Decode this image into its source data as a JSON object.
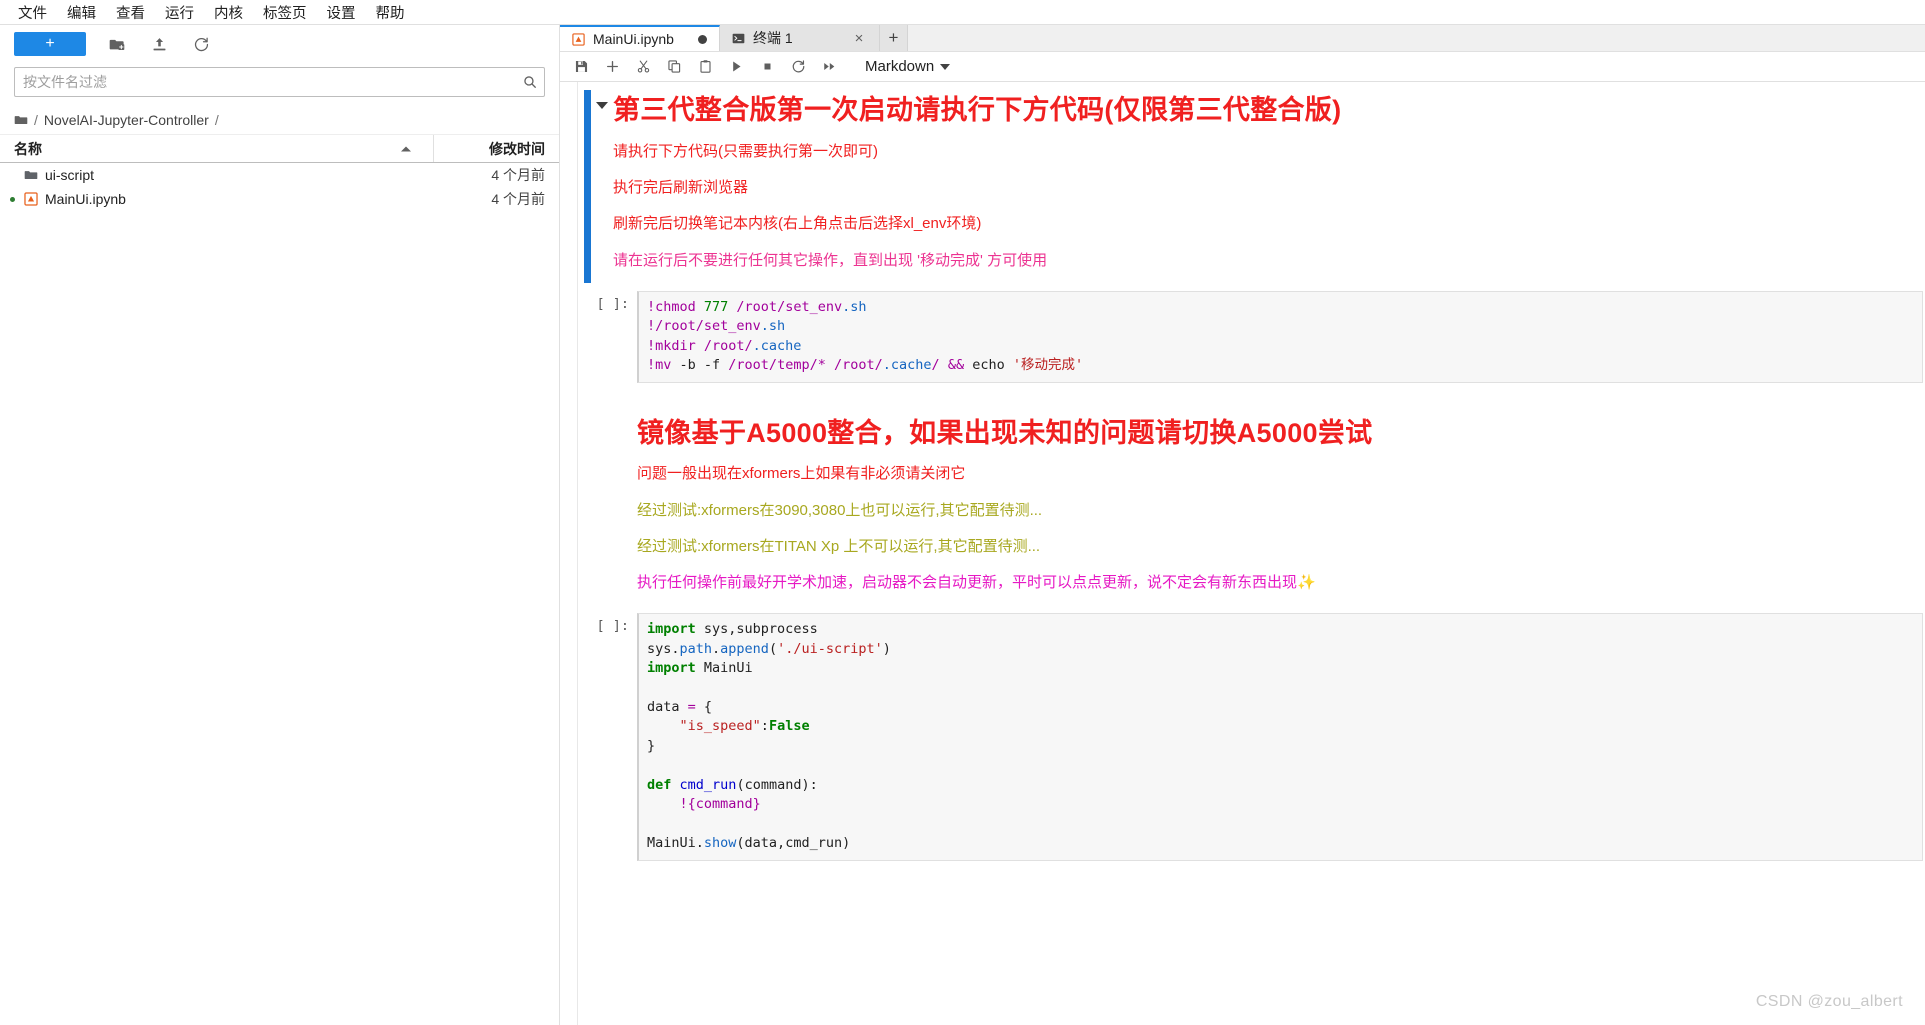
{
  "menubar": {
    "items": [
      {
        "label": "文件",
        "name": "menu-file"
      },
      {
        "label": "编辑",
        "name": "menu-edit"
      },
      {
        "label": "查看",
        "name": "menu-view"
      },
      {
        "label": "运行",
        "name": "menu-run"
      },
      {
        "label": "内核",
        "name": "menu-kernel"
      },
      {
        "label": "标签页",
        "name": "menu-tabs"
      },
      {
        "label": "设置",
        "name": "menu-settings"
      },
      {
        "label": "帮助",
        "name": "menu-help"
      }
    ]
  },
  "sidebar": {
    "toolbar": {
      "new_label": "+",
      "new_color": "#1e88e5",
      "icons": [
        {
          "name": "new-folder-icon",
          "title": "新建文件夹"
        },
        {
          "name": "upload-icon",
          "title": "上传"
        },
        {
          "name": "refresh-icon",
          "title": "刷新"
        }
      ]
    },
    "filter": {
      "placeholder": "按文件名过滤",
      "value": "",
      "icon": "search-icon"
    },
    "breadcrumb": {
      "icon": "folder-icon",
      "lead_sep": "/",
      "path": "NovelAI-Jupyter-Controller",
      "trail_sep": "/"
    },
    "list_headers": {
      "name": "名称",
      "modified": "修改时间",
      "sort": "ascending"
    },
    "files": [
      {
        "name": "ui-script",
        "modified": "4 个月前",
        "type": "folder",
        "icon": "folder-icon",
        "running": false
      },
      {
        "name": "MainUi.ipynb",
        "modified": "4 个月前",
        "type": "notebook",
        "icon": "notebook-icon",
        "running": true
      }
    ]
  },
  "tabs": [
    {
      "label": "MainUi.ipynb",
      "icon": "notebook-icon",
      "active": true,
      "dirty": true,
      "closable": false
    },
    {
      "label": "终端 1",
      "icon": "terminal-icon",
      "active": false,
      "dirty": false,
      "closable": true,
      "close_label": "×"
    }
  ],
  "tab_add_label": "+",
  "notebook_toolbar": {
    "buttons": [
      {
        "name": "save-button",
        "icon": "save-icon",
        "title": "保存"
      },
      {
        "name": "insert-cell-button",
        "icon": "plus-icon",
        "title": "插入单元"
      },
      {
        "name": "cut-cell-button",
        "icon": "scissors-icon",
        "title": "剪切"
      },
      {
        "name": "copy-cell-button",
        "icon": "copy-icon",
        "title": "复制"
      },
      {
        "name": "paste-cell-button",
        "icon": "paste-icon",
        "title": "粘贴"
      },
      {
        "name": "run-cell-button",
        "icon": "play-icon",
        "title": "运行"
      },
      {
        "name": "stop-kernel-button",
        "icon": "stop-icon",
        "title": "中断"
      },
      {
        "name": "restart-kernel-button",
        "icon": "restart-icon",
        "title": "重启"
      },
      {
        "name": "restart-run-all-button",
        "icon": "fast-forward-icon",
        "title": "重启并运行全部"
      }
    ],
    "cell_type": "Markdown"
  },
  "notebook": {
    "cells": [
      {
        "id": "cell-md-1",
        "type": "markdown",
        "selected": true,
        "collapsible": true,
        "heading": "第三代整合版第一次启动请执行下方代码(仅限第三代整合版)",
        "heading_color": "#f02020",
        "paragraphs": [
          {
            "text": "请执行下方代码(只需要执行第一次即可)",
            "color": "#f02020"
          },
          {
            "text": "执行完后刷新浏览器",
            "color": "#f02020"
          },
          {
            "text": "刷新完后切换笔记本内核(右上角点击后选择xl_env环境)",
            "color": "#f02020"
          },
          {
            "text": "请在运行后不要进行任何其它操作，直到出现 '移动完成' 方可使用",
            "color": "#ec3391"
          }
        ]
      },
      {
        "id": "cell-code-1",
        "type": "code",
        "prompt": "[ ]:",
        "lines": [
          [
            {
              "t": "!chmod ",
              "c": "op"
            },
            {
              "t": "777 ",
              "c": "nm"
            },
            {
              "t": "/root/set_env",
              "c": "op"
            },
            {
              "t": ".sh",
              "c": "at"
            }
          ],
          [
            {
              "t": "!/root/set_env",
              "c": "op"
            },
            {
              "t": ".sh",
              "c": "at"
            }
          ],
          [
            {
              "t": "!mkdir /root/",
              "c": "op"
            },
            {
              "t": ".cache",
              "c": "at"
            }
          ],
          [
            {
              "t": "!mv ",
              "c": "op"
            },
            {
              "t": "-b -f /root/temp/* /root/",
              "c": "op"
            },
            {
              "t": ".cache",
              "c": "at"
            },
            {
              "t": "/ ",
              "c": "op"
            },
            {
              "t": "&& ",
              "c": "op"
            },
            {
              "t": "echo ",
              "c": "plain"
            },
            {
              "t": "'移动完成'",
              "c": "st"
            }
          ]
        ]
      },
      {
        "id": "cell-md-2",
        "type": "markdown",
        "selected": false,
        "collapsible": false,
        "heading": "镜像基于A5000整合，如果出现未知的问题请切换A5000尝试",
        "heading_color": "#f02020",
        "paragraphs": [
          {
            "text": "问题一般出现在xformers上如果有非必须请关闭它",
            "color": "#f02020"
          },
          {
            "text": "经过测试:xformers在3090,3080上也可以运行,其它配置待测...",
            "color": "#a8a820"
          },
          {
            "text": "经过测试:xformers在TITAN Xp 上不可以运行,其它配置待测...",
            "color": "#a8a820"
          },
          {
            "text": "执行任何操作前最好开学术加速，启动器不会自动更新，平时可以点点更新，说不定会有新东西出现✨",
            "color": "#e619c4"
          }
        ]
      },
      {
        "id": "cell-code-2",
        "type": "code",
        "prompt": "[ ]:",
        "lines": [
          [
            {
              "t": "import",
              "c": "k"
            },
            {
              "t": " sys,subprocess",
              "c": "plain"
            }
          ],
          [
            {
              "t": "sys",
              "c": "plain"
            },
            {
              "t": ".",
              "c": "plain"
            },
            {
              "t": "path",
              "c": "at"
            },
            {
              "t": ".",
              "c": "plain"
            },
            {
              "t": "append",
              "c": "at"
            },
            {
              "t": "(",
              "c": "plain"
            },
            {
              "t": "'./ui-script'",
              "c": "st"
            },
            {
              "t": ")",
              "c": "plain"
            }
          ],
          [
            {
              "t": "import",
              "c": "k"
            },
            {
              "t": " MainUi",
              "c": "plain"
            }
          ],
          [
            {
              "t": "",
              "c": "plain"
            }
          ],
          [
            {
              "t": "data ",
              "c": "plain"
            },
            {
              "t": "=",
              "c": "op"
            },
            {
              "t": " {",
              "c": "plain"
            }
          ],
          [
            {
              "t": "    ",
              "c": "plain"
            },
            {
              "t": "\"is_speed\"",
              "c": "st"
            },
            {
              "t": ":",
              "c": "plain"
            },
            {
              "t": "False",
              "c": "bi"
            }
          ],
          [
            {
              "t": "}",
              "c": "plain"
            }
          ],
          [
            {
              "t": "",
              "c": "plain"
            }
          ],
          [
            {
              "t": "def",
              "c": "k"
            },
            {
              "t": " ",
              "c": "plain"
            },
            {
              "t": "cmd_run",
              "c": "fn"
            },
            {
              "t": "(command):",
              "c": "plain"
            }
          ],
          [
            {
              "t": "    ",
              "c": "plain"
            },
            {
              "t": "!{command}",
              "c": "op"
            }
          ],
          [
            {
              "t": "",
              "c": "plain"
            }
          ],
          [
            {
              "t": "MainUi",
              "c": "plain"
            },
            {
              "t": ".",
              "c": "plain"
            },
            {
              "t": "show",
              "c": "at"
            },
            {
              "t": "(data,cmd_run)",
              "c": "plain"
            }
          ]
        ]
      }
    ]
  },
  "watermark": "CSDN @zou_albert"
}
